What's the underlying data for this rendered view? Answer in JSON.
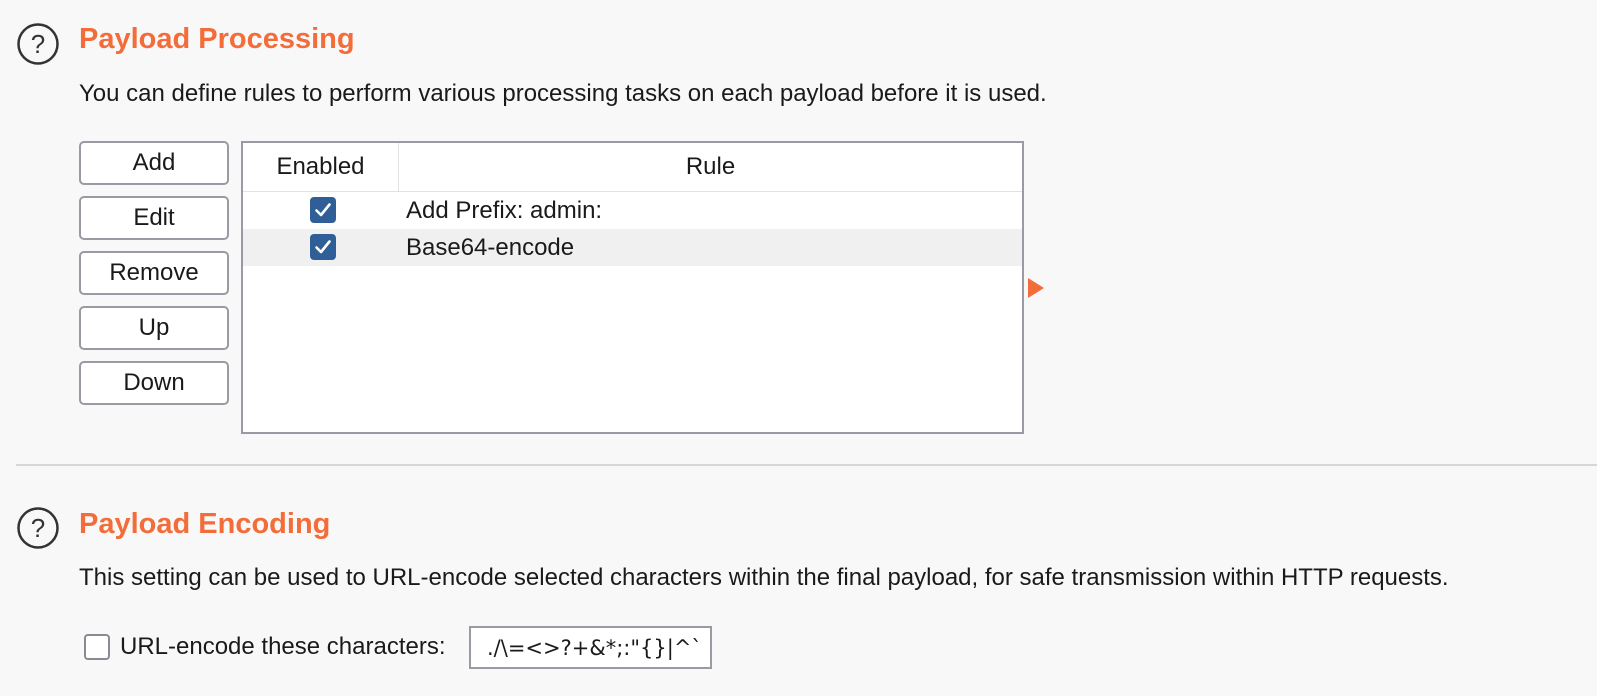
{
  "processing": {
    "title": "Payload Processing",
    "description": "You can define rules to perform various processing tasks on each payload before it is used.",
    "buttons": {
      "add": "Add",
      "edit": "Edit",
      "remove": "Remove",
      "up": "Up",
      "down": "Down"
    },
    "table": {
      "columns": [
        "Enabled",
        "Rule"
      ],
      "rows": [
        {
          "enabled": true,
          "rule": "Add Prefix: admin:"
        },
        {
          "enabled": true,
          "rule": "Base64-encode"
        }
      ]
    }
  },
  "encoding": {
    "title": "Payload Encoding",
    "description": "This setting can be used to URL-encode selected characters within the final payload, for safe transmission within HTTP requests.",
    "checkbox_label": "URL-encode these characters:",
    "checkbox_checked": false,
    "characters": "./\\=<>?+&*;:\"{}|^`"
  },
  "colors": {
    "accent": "#f36d3a",
    "checkbox_checked": "#2f5f96",
    "border": "#9a9aa3",
    "background": "#f8f8f8"
  },
  "icons": {
    "help": "help-circle-icon",
    "check": "check-icon",
    "expand": "expand-arrow-icon"
  }
}
